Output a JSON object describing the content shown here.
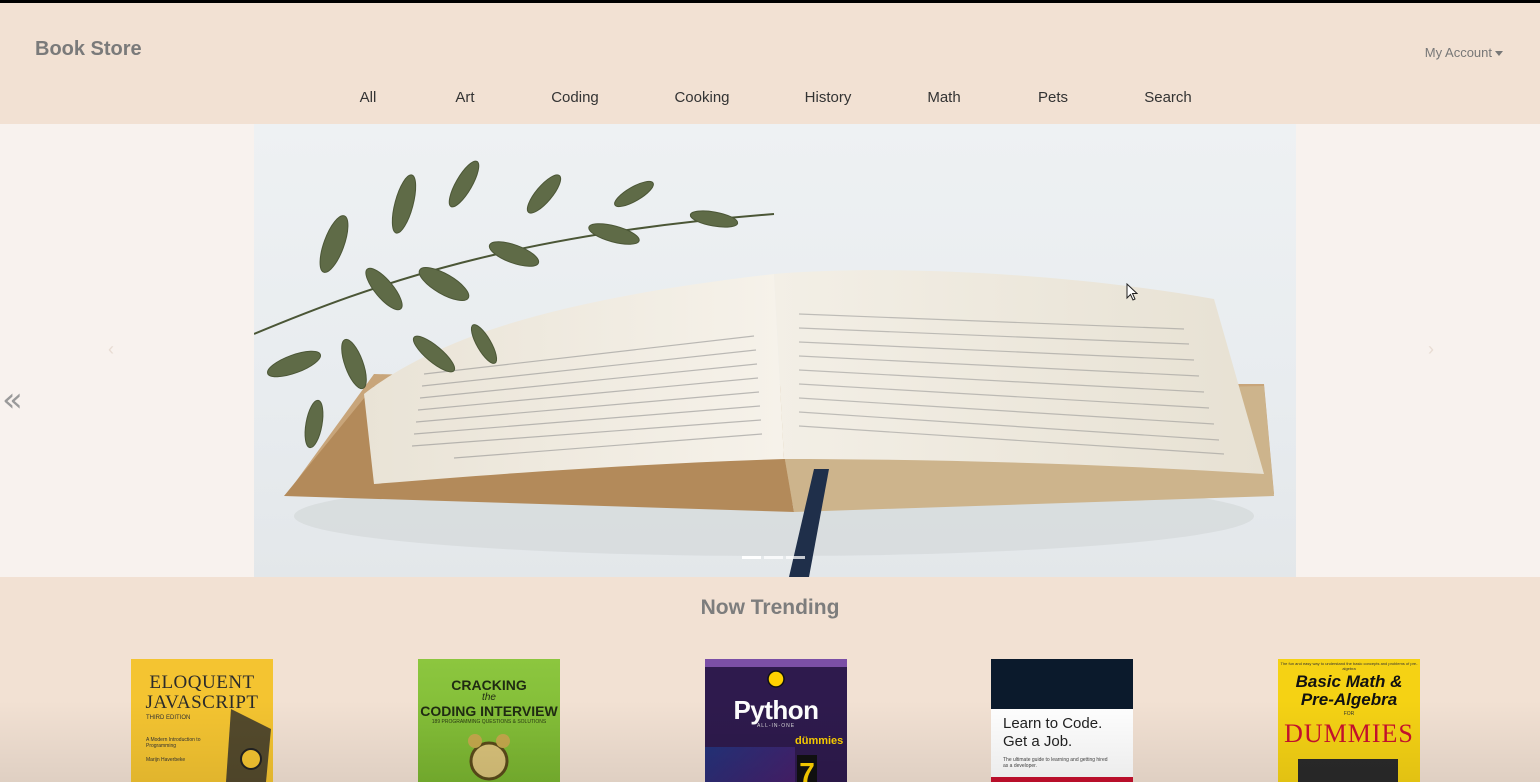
{
  "header": {
    "brand": "Book Store",
    "account_label": "My Account"
  },
  "nav": {
    "items": [
      {
        "label": "All"
      },
      {
        "label": "Art"
      },
      {
        "label": "Coding"
      },
      {
        "label": "Cooking"
      },
      {
        "label": "History"
      },
      {
        "label": "Math"
      },
      {
        "label": "Pets"
      },
      {
        "label": "Search"
      }
    ]
  },
  "carousel": {
    "prev_icon": "chevron-left-icon",
    "next_icon": "chevron-right-icon",
    "active_slide": 1,
    "slide_count": 3
  },
  "trending": {
    "title": "Now Trending",
    "books": [
      {
        "line1": "ELOQUENT",
        "line2": "JAVASCRIPT",
        "edition": "THIRD EDITION",
        "subtitle": "A Modern Introduction to Programming",
        "author": "Marijn Haverbeke"
      },
      {
        "line1": "CRACKING",
        "line2": "the",
        "line3": "CODING INTERVIEW",
        "subtitle": "189 PROGRAMMING QUESTIONS & SOLUTIONS"
      },
      {
        "kicker": "LEARNING MADE EASY",
        "title": "Python",
        "subtitle": "ALL-IN-ONE",
        "brand": "dümmies",
        "number": "7"
      },
      {
        "line1": "Learn to Code.",
        "line2": "Get a Job.",
        "subtitle": "The ultimate guide to learning and getting hired as a developer."
      },
      {
        "kicker": "The fun and easy way to understand the basic concepts and problems of pre-algebra",
        "line1": "Basic Math &",
        "line2": "Pre-Algebra",
        "for": "FOR",
        "brand": "DUMMIES"
      }
    ]
  },
  "colors": {
    "header_bg": "#f2e1d3",
    "hero_bg": "#f8f2ee",
    "brand_text": "#7a7a7a"
  }
}
